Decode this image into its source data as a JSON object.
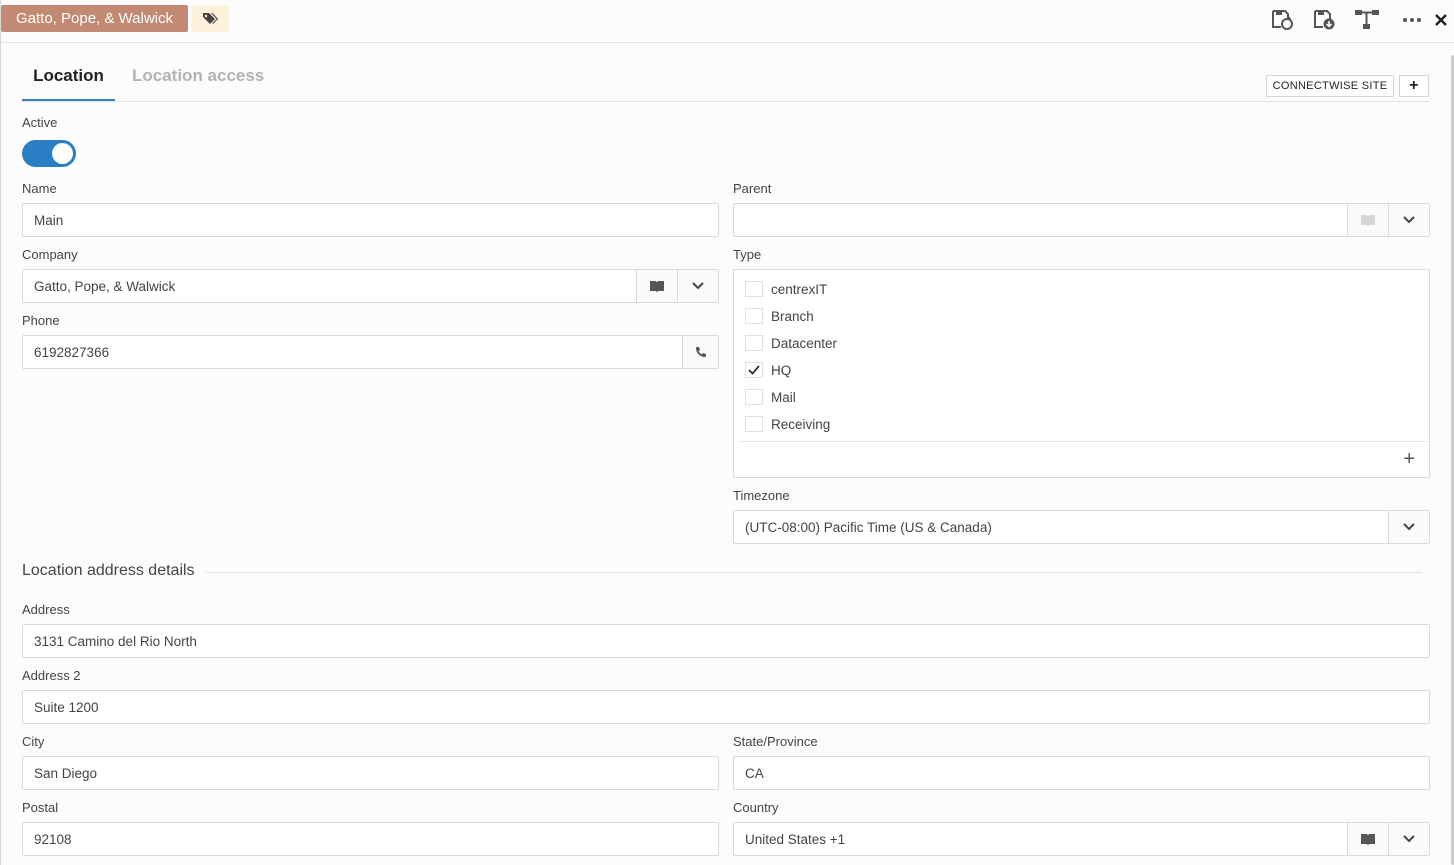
{
  "header": {
    "company_chip": "Gatto, Pope, & Walwick",
    "icons": [
      "tag-icon",
      "save-refresh-icon",
      "save-download-icon",
      "hierarchy-icon",
      "more-icon",
      "close-icon"
    ]
  },
  "tabs": [
    {
      "label": "Location",
      "active": true
    },
    {
      "label": "Location access",
      "active": false
    }
  ],
  "toolbar": {
    "connectwise_label": "CONNECTWISE SITE",
    "add_label": "+"
  },
  "form": {
    "active_label": "Active",
    "active_value": true,
    "name_label": "Name",
    "name_value": "Main",
    "parent_label": "Parent",
    "parent_value": "",
    "company_label": "Company",
    "company_value": "Gatto, Pope, & Walwick",
    "type_label": "Type",
    "type_options": [
      {
        "label": "centrexIT",
        "checked": false
      },
      {
        "label": "Branch",
        "checked": false
      },
      {
        "label": "Datacenter",
        "checked": false
      },
      {
        "label": "HQ",
        "checked": true
      },
      {
        "label": "Mail",
        "checked": false
      },
      {
        "label": "Receiving",
        "checked": false
      }
    ],
    "type_add_label": "+",
    "phone_label": "Phone",
    "phone_value": "6192827366",
    "timezone_label": "Timezone",
    "timezone_value": "(UTC-08:00) Pacific Time (US & Canada)"
  },
  "address": {
    "section_title": "Location address details",
    "address_label": "Address",
    "address_value": "3131 Camino del Rio North",
    "address2_label": "Address 2",
    "address2_value": "Suite 1200",
    "city_label": "City",
    "city_value": "San Diego",
    "state_label": "State/Province",
    "state_value": "CA",
    "postal_label": "Postal",
    "postal_value": "92108",
    "country_label": "Country",
    "country_value": "United States +1"
  },
  "colors": {
    "company_chip": "#c38a73",
    "accent": "#2b7fc4"
  }
}
